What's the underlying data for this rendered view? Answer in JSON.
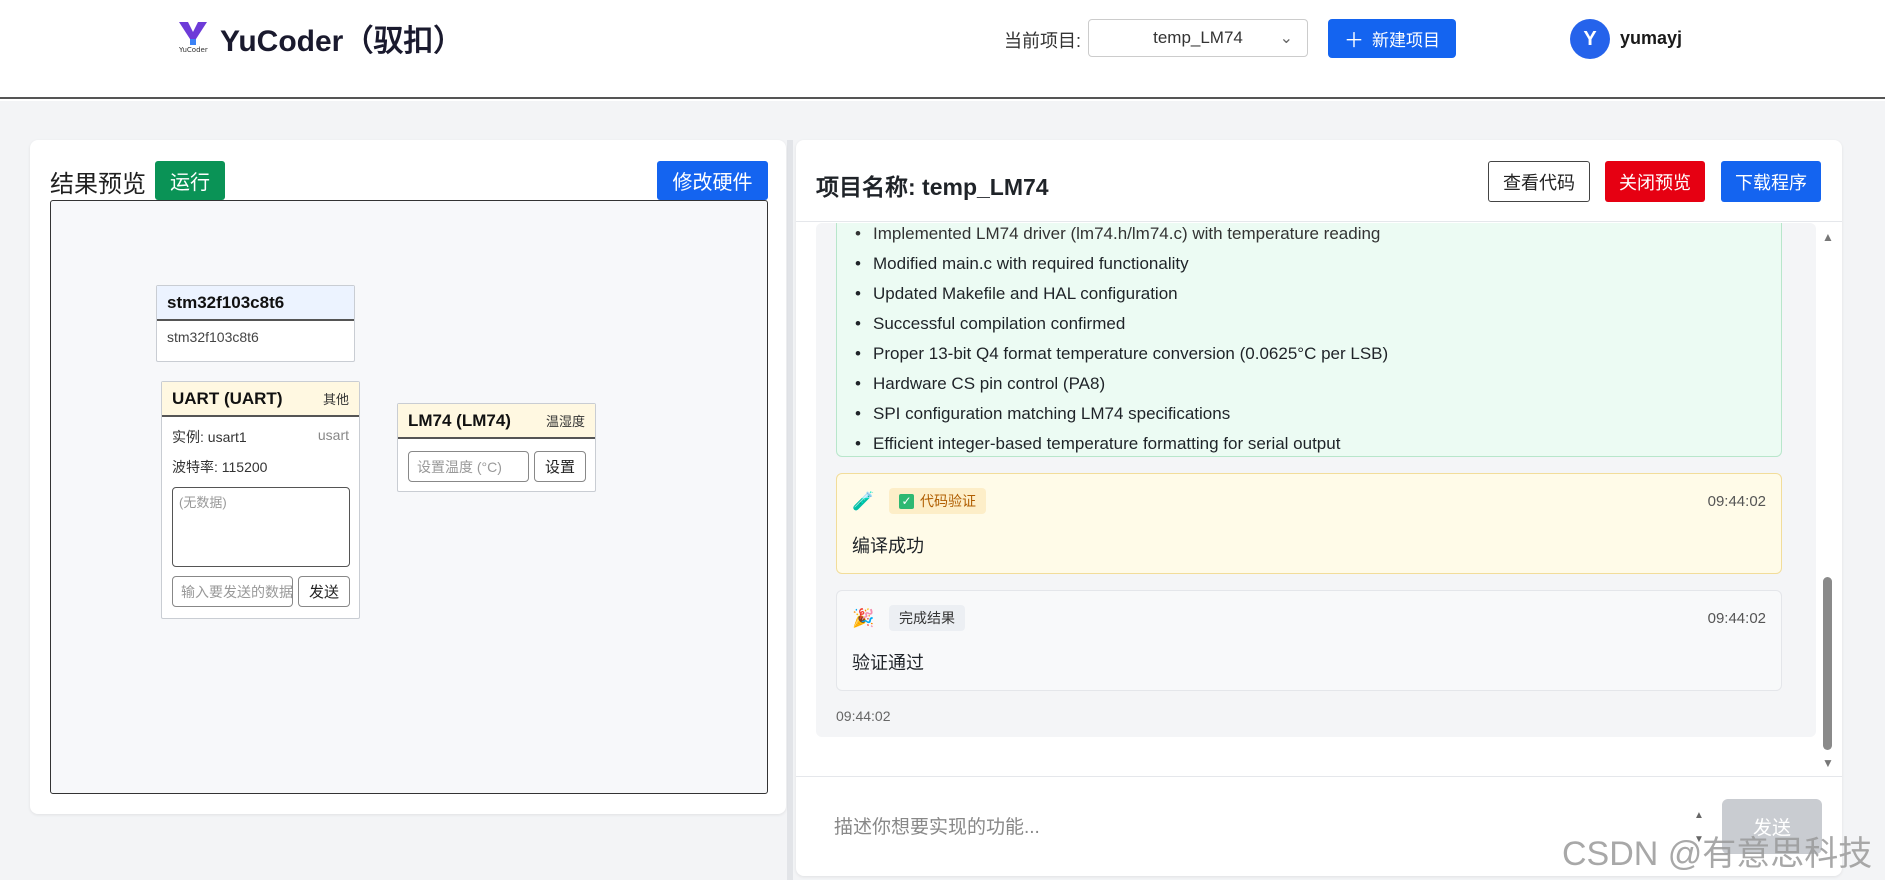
{
  "header": {
    "app_title": "YuCoder（驭扣）",
    "project_label": "当前项目:",
    "project_selected": "temp_LM74",
    "new_project_label": "新建项目",
    "user_initial": "Y",
    "username": "yumayj"
  },
  "left": {
    "preview_title": "结果预览",
    "run_label": "运行",
    "modify_hw_label": "修改硬件",
    "mcu": {
      "name": "stm32f103c8t6",
      "sub": "stm32f103c8t6"
    },
    "uart": {
      "name": "UART (UART)",
      "tag": "其他",
      "instance": "实例: usart1",
      "instance_type": "usart",
      "baud": "波特率: 115200",
      "data_placeholder": "(无数据)",
      "input_placeholder": "输入要发送的数据",
      "send_label": "发送"
    },
    "lm74": {
      "name": "LM74 (LM74)",
      "tag": "温湿度",
      "input_placeholder": "设置温度 (°C)",
      "set_label": "设置"
    }
  },
  "right": {
    "title": "项目名称: temp_LM74",
    "view_code_label": "查看代码",
    "close_preview_label": "关闭预览",
    "download_label": "下载程序",
    "summary_items": [
      "Implemented LM74 driver (lm74.h/lm74.c) with temperature reading",
      "Modified main.c with required functionality",
      "Updated Makefile and HAL configuration",
      "Successful compilation confirmed",
      "Proper 13-bit Q4 format temperature conversion (0.0625°C per LSB)",
      "Hardware CS pin control (PA8)",
      "SPI configuration matching LM74 specifications",
      "Efficient integer-based temperature formatting for serial output"
    ],
    "verify": {
      "tag": "代码验证",
      "time": "09:44:02",
      "body": "编译成功"
    },
    "done": {
      "tag": "完成结果",
      "time": "09:44:02",
      "body": "验证通过"
    },
    "chat_time": "09:44:02",
    "composer_placeholder": "描述你想要实现的功能...",
    "send_label": "发送"
  },
  "watermark": "CSDN @有意思科技"
}
